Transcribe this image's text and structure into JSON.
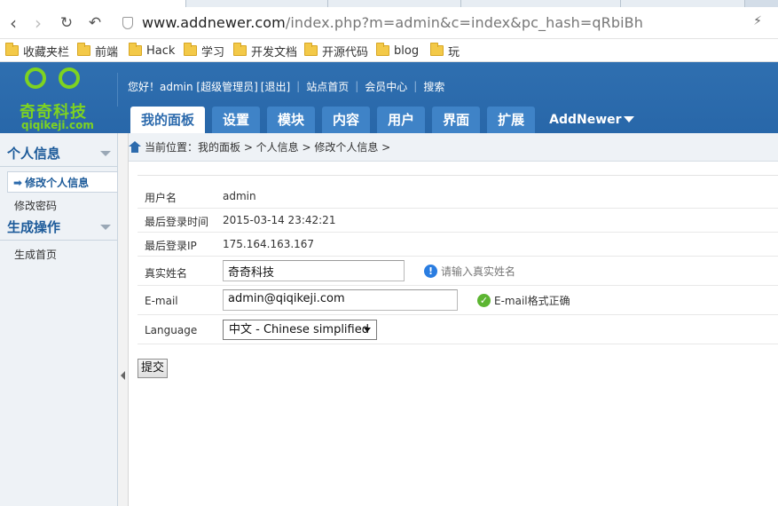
{
  "browser": {
    "url_host": "www.addnewer.com",
    "url_rest": "/index.php?m=admin&c=index&pc_hash=qRbiBh",
    "bookmarks": [
      "收藏夹栏",
      "前端",
      "Hack",
      "学习",
      "开发文档",
      "开源代码",
      "blog",
      "玩"
    ]
  },
  "logo": {
    "brand_cn": "奇奇科技",
    "brand_en": "qiqikeji.com"
  },
  "topbar": {
    "greeting": "您好！admin [超级管理员]",
    "logout": "[退出]",
    "site_home": "站点首页",
    "member_center": "会员中心",
    "search": "搜索"
  },
  "mainnav": {
    "items": [
      "我的面板",
      "设置",
      "模块",
      "内容",
      "用户",
      "界面",
      "扩展"
    ],
    "more": "AddNewer"
  },
  "sidebar": {
    "section1": "个人信息",
    "item_edit_info": "修改个人信息",
    "item_change_pwd": "修改密码",
    "section2": "生成操作",
    "item_gen_home": "生成首页"
  },
  "breadcrumb": {
    "text": "当前位置：我的面板 > 个人信息 > 修改个人信息 >"
  },
  "form": {
    "username_label": "用户名",
    "username_value": "admin",
    "last_login_time_label": "最后登录时间",
    "last_login_time_value": "2015-03-14 23:42:21",
    "last_login_ip_label": "最后登录IP",
    "last_login_ip_value": "175.164.163.167",
    "realname_label": "真实姓名",
    "realname_value": "奇奇科技",
    "realname_hint": "请输入真实姓名",
    "email_label": "E-mail",
    "email_value": "admin@qiqikeji.com",
    "email_hint": "E-mail格式正确",
    "language_label": "Language",
    "language_value": "中文 - Chinese simplified",
    "submit_label": "提交"
  },
  "colors": {
    "header_blue": "#2d6bad",
    "logo_green": "#7ed321"
  }
}
